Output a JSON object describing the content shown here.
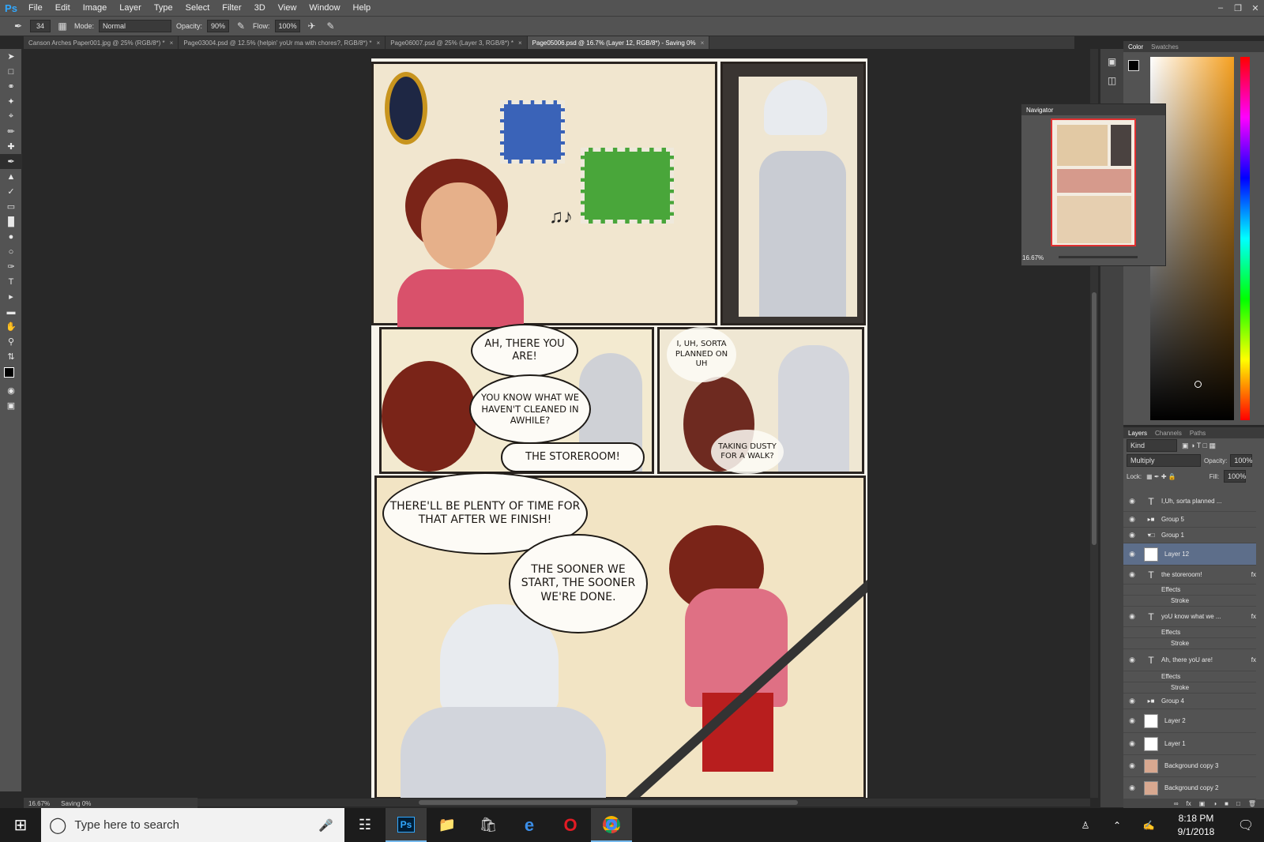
{
  "app": {
    "logo": "Ps"
  },
  "menu": [
    "File",
    "Edit",
    "Image",
    "Layer",
    "Type",
    "Select",
    "Filter",
    "3D",
    "View",
    "Window",
    "Help"
  ],
  "options": {
    "brush_size": "34",
    "mode_label": "Mode:",
    "mode_value": "Normal",
    "opacity_label": "Opacity:",
    "opacity_value": "90%",
    "flow_label": "Flow:",
    "flow_value": "100%"
  },
  "tabs": [
    {
      "label": "Canson Arches Paper001.jpg @ 25% (RGB/8*) *"
    },
    {
      "label": "Page03004.psd @ 12.5% (helpin' yoUr ma with chores?, RGB/8*) *"
    },
    {
      "label": "Page06007.psd @ 25% (Layer 3, RGB/8*) *"
    },
    {
      "label": "Page05006.psd @ 16.7% (Layer 12, RGB/8*) - Saving 0%"
    }
  ],
  "comic": {
    "b1": "AH, THERE YOU ARE!",
    "b2": "YOU KNOW WHAT WE HAVEN'T CLEANED IN AWHILE?",
    "b3": "THE STOREROOM!",
    "b4": "I, UH, SORTA PLANNED ON UH",
    "b5": "TAKING DUSTY FOR A WALK?",
    "b6": "THERE'LL BE PLENTY OF TIME FOR THAT AFTER WE FINISH!",
    "b7": "THE SOONER WE START, THE SOONER WE'RE DONE."
  },
  "status": {
    "zoom": "16.67%",
    "saving": "Saving 0%"
  },
  "color_panel": {
    "tabs": [
      "Color",
      "Swatches"
    ]
  },
  "navigator": {
    "title": "Navigator",
    "zoom": "16.67%"
  },
  "layers_panel": {
    "tabs": [
      "Layers",
      "Channels",
      "Paths"
    ],
    "kind": "Kind",
    "blend": "Multiply",
    "opacity_label": "Opacity:",
    "opacity": "100%",
    "lock_label": "Lock:",
    "fill_label": "Fill:",
    "fill": "100%",
    "layers": [
      {
        "name": "I,Uh, sorta  planned ...",
        "type": "text"
      },
      {
        "name": "Group 5",
        "type": "group"
      },
      {
        "name": "Group 1",
        "type": "group-open"
      },
      {
        "name": "Layer 12",
        "type": "layer"
      },
      {
        "name": "the storeroom!",
        "type": "text",
        "fx": "fx"
      },
      {
        "name": "Effects",
        "type": "effect"
      },
      {
        "name": "Stroke",
        "type": "effect"
      },
      {
        "name": "yoU know what we ...",
        "type": "text",
        "fx": "fx"
      },
      {
        "name": "Effects",
        "type": "effect"
      },
      {
        "name": "Stroke",
        "type": "effect"
      },
      {
        "name": "Ah, there yoU are!",
        "type": "text",
        "fx": "fx"
      },
      {
        "name": "Effects",
        "type": "effect"
      },
      {
        "name": "Stroke",
        "type": "effect"
      },
      {
        "name": "Group 4",
        "type": "group"
      },
      {
        "name": "Layer 2",
        "type": "layer"
      },
      {
        "name": "Layer 1",
        "type": "layer"
      },
      {
        "name": "Background copy 3",
        "type": "image"
      },
      {
        "name": "Background copy 2",
        "type": "image"
      }
    ]
  },
  "taskbar": {
    "search_placeholder": "Type here to search",
    "time": "8:18 PM",
    "date": "9/1/2018"
  },
  "colors": {
    "ps_bg": "#535353",
    "canvas_bg": "#282828",
    "selection": "#5d6e8a",
    "ps_blue": "#31a8ff"
  }
}
